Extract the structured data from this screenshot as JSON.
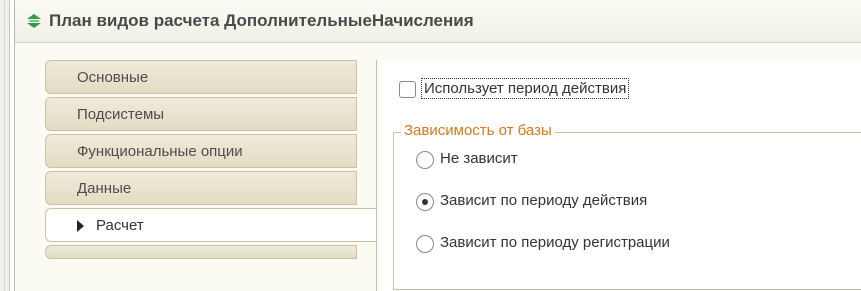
{
  "window": {
    "title": "План видов расчета ДополнительныеНачисления",
    "icon": "plan-of-calculation-types-icon"
  },
  "tabs": [
    {
      "label": "Основные",
      "active": false
    },
    {
      "label": "Подсистемы",
      "active": false
    },
    {
      "label": "Функциональные опции",
      "active": false
    },
    {
      "label": "Данные",
      "active": false
    },
    {
      "label": "Расчет",
      "active": true
    }
  ],
  "calculation_panel": {
    "uses_action_period": {
      "label": "Использует период действия",
      "checked": false
    },
    "base_dependence": {
      "caption": "Зависимость от базы",
      "options": [
        {
          "label": "Не зависит",
          "selected": false
        },
        {
          "label": "Зависит по периоду действия",
          "selected": true
        },
        {
          "label": "Зависит по периоду регистрации",
          "selected": false
        }
      ]
    }
  },
  "colors": {
    "group_caption": "#d4781f",
    "tab_background": "#e8e2cc",
    "title_icon": "#2f9b4c"
  }
}
